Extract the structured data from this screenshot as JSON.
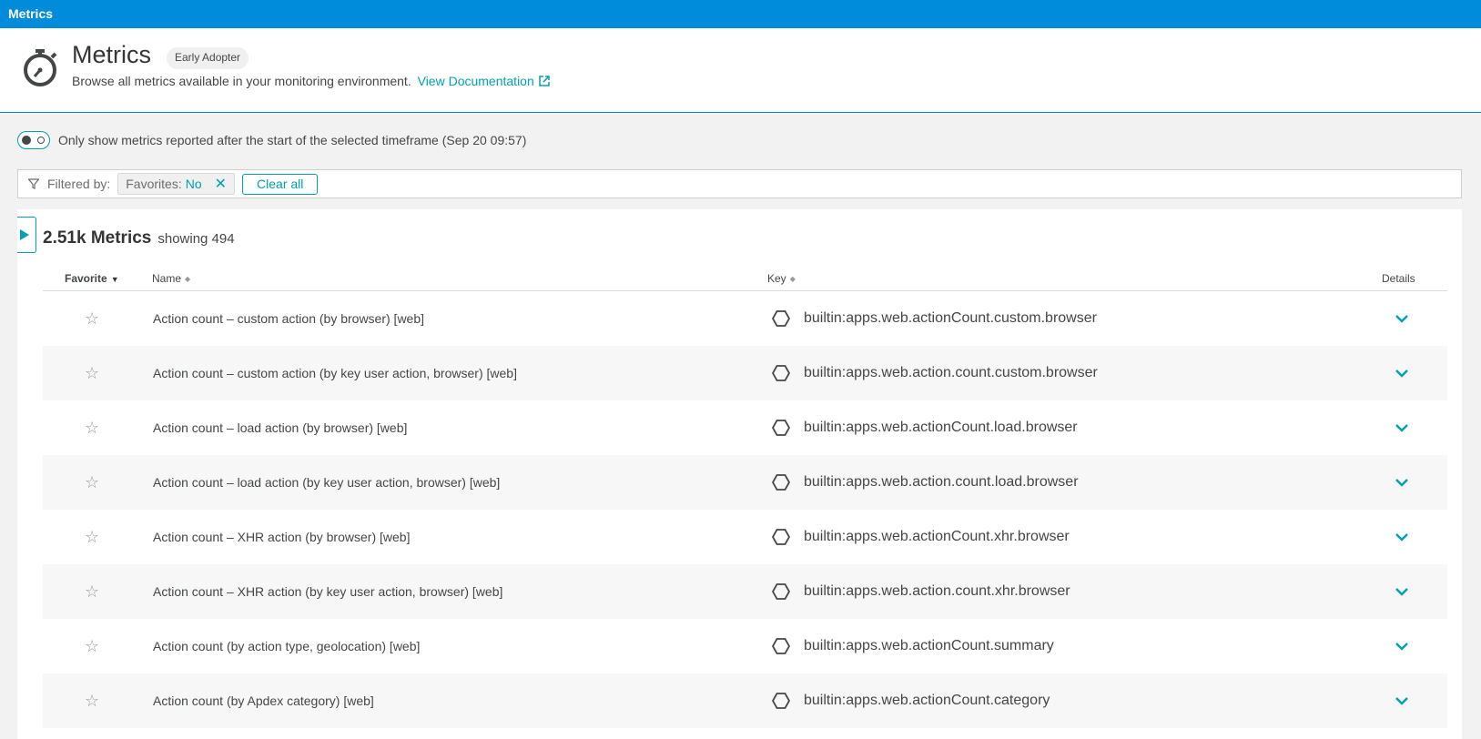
{
  "topbar": {
    "title": "Metrics"
  },
  "header": {
    "title": "Metrics",
    "badge": "Early Adopter",
    "description": "Browse all metrics available in your monitoring environment.",
    "doc_link": "View Documentation"
  },
  "toggle": {
    "label": "Only show metrics reported after the start of the selected timeframe (Sep 20 09:57)",
    "enabled": false
  },
  "filter": {
    "label": "Filtered by:",
    "chip_key": "Favorites:",
    "chip_value": "No",
    "clear_label": "Clear all"
  },
  "summary": {
    "count": "2.51k Metrics",
    "showing": "showing 494"
  },
  "table": {
    "columns": {
      "favorite": "Favorite",
      "name": "Name",
      "key": "Key",
      "details": "Details"
    },
    "rows": [
      {
        "name": "Action count – custom action (by browser) [web]",
        "key": "builtin:apps.web.actionCount.custom.browser"
      },
      {
        "name": "Action count – custom action (by key user action, browser) [web]",
        "key": "builtin:apps.web.action.count.custom.browser"
      },
      {
        "name": "Action count – load action (by browser) [web]",
        "key": "builtin:apps.web.actionCount.load.browser"
      },
      {
        "name": "Action count – load action (by key user action, browser) [web]",
        "key": "builtin:apps.web.action.count.load.browser"
      },
      {
        "name": "Action count – XHR action (by browser) [web]",
        "key": "builtin:apps.web.actionCount.xhr.browser"
      },
      {
        "name": "Action count – XHR action (by key user action, browser) [web]",
        "key": "builtin:apps.web.action.count.xhr.browser"
      },
      {
        "name": "Action count (by action type, geolocation) [web]",
        "key": "builtin:apps.web.actionCount.summary"
      },
      {
        "name": "Action count (by Apdex category) [web]",
        "key": "builtin:apps.web.actionCount.category"
      }
    ]
  },
  "colors": {
    "brand": "#008cdb",
    "accent": "#00a1b2"
  }
}
